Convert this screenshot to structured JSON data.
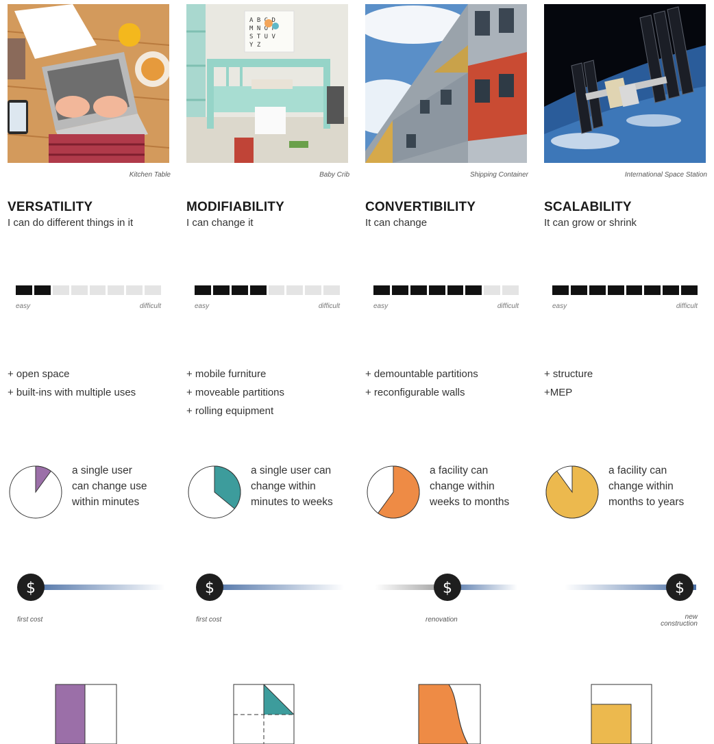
{
  "columns": [
    {
      "caption": "Kitchen Table",
      "title": "VERSATILITY",
      "subtitle": "I can do different things in it",
      "scale": {
        "filled": 2,
        "total": 8,
        "easy_label": "easy",
        "difficult_label": "difficult"
      },
      "features": [
        "+ open space",
        "+ built-ins with multiple uses"
      ],
      "change": {
        "fraction": 0.1,
        "color": "#9b6fa8",
        "lines": [
          "a single user",
          "can change use",
          "within minutes"
        ]
      },
      "cost": {
        "label": "first cost",
        "position": "start",
        "symbol": "$"
      },
      "diagram_color": "#9b6fa8"
    },
    {
      "caption": "Baby Crib",
      "title": "MODIFIABILITY",
      "subtitle": "I can change it",
      "scale": {
        "filled": 4,
        "total": 8,
        "easy_label": "easy",
        "difficult_label": "difficult"
      },
      "features": [
        "+ mobile furniture",
        "+ moveable partitions",
        "+ rolling equipment"
      ],
      "change": {
        "fraction": 0.36,
        "color": "#3d9c9c",
        "lines": [
          "a single user can",
          "change within",
          "minutes to weeks"
        ]
      },
      "cost": {
        "label": "first cost",
        "position": "start",
        "symbol": "$"
      },
      "diagram_color": "#3d9c9c"
    },
    {
      "caption": "Shipping Container",
      "title": "CONVERTIBILITY",
      "subtitle": "It can change",
      "scale": {
        "filled": 6,
        "total": 8,
        "easy_label": "easy",
        "difficult_label": "difficult"
      },
      "features": [
        "+ demountable partitions",
        "+ reconfigurable walls"
      ],
      "change": {
        "fraction": 0.6,
        "color": "#ee8b45",
        "lines": [
          "a facility can",
          "change within",
          "weeks to months"
        ]
      },
      "cost": {
        "label": "renovation",
        "position": "middle",
        "symbol": "$"
      },
      "diagram_color": "#ee8b45"
    },
    {
      "caption": "International Space Station",
      "title": "SCALABILITY",
      "subtitle": "It can grow or shrink",
      "scale": {
        "filled": 8,
        "total": 8,
        "easy_label": "easy",
        "difficult_label": "difficult"
      },
      "features": [
        "+ structure",
        "+MEP"
      ],
      "change": {
        "fraction": 0.9,
        "color": "#ecb94e",
        "lines": [
          "a facility can",
          "change within",
          "months to years"
        ]
      },
      "cost": {
        "label": "new construction",
        "label_lines": [
          "new",
          "construction"
        ],
        "position": "end",
        "symbol": "$"
      },
      "diagram_color": "#ecb94e"
    }
  ],
  "colors": {
    "scale_filled": "#111111",
    "scale_empty": "#e4e4e4",
    "cost_blue": "#4a6fa5",
    "cost_grey": "#9a9a9a"
  }
}
